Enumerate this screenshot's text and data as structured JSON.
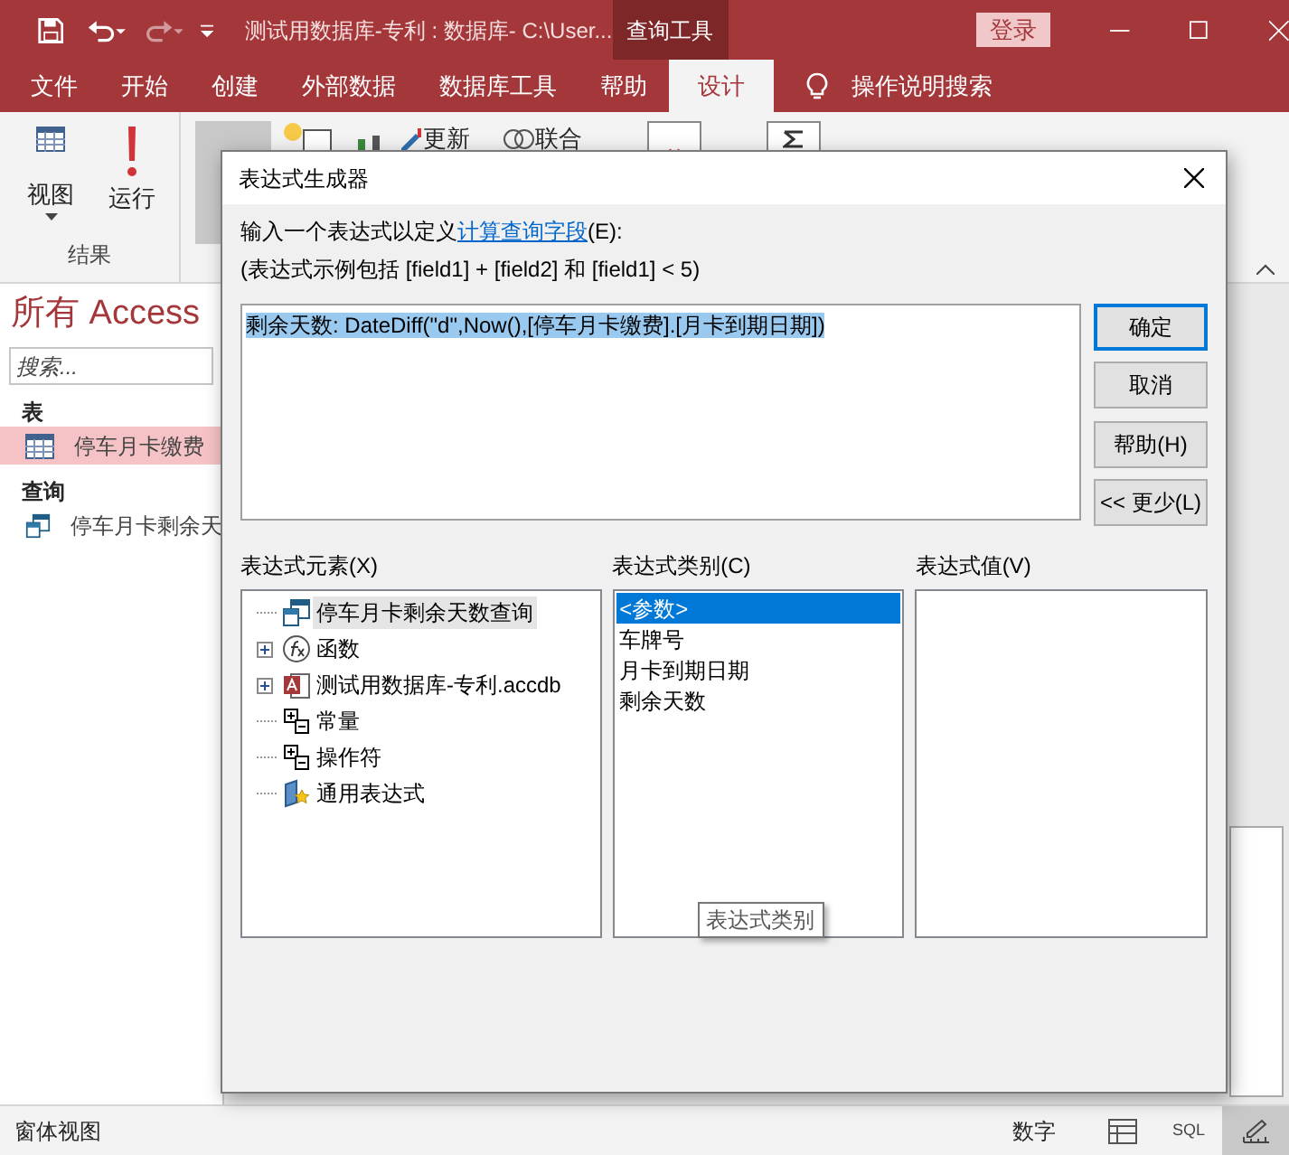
{
  "title_bar": {
    "title": "测试用数据库-专利 : 数据库- C:\\User...",
    "context_tab": "查询工具",
    "sign_in": "登录"
  },
  "ribbon_tabs": [
    {
      "label": "文件",
      "selected": false
    },
    {
      "label": "开始",
      "selected": false
    },
    {
      "label": "创建",
      "selected": false
    },
    {
      "label": "外部数据",
      "selected": false
    },
    {
      "label": "数据库工具",
      "selected": false
    },
    {
      "label": "帮助",
      "selected": false
    },
    {
      "label": "设计",
      "selected": true
    }
  ],
  "tell_me": "操作说明搜索",
  "ribbon": {
    "view": "视图",
    "run": "运行",
    "group_label": "结果",
    "update": "更新",
    "union": "联合"
  },
  "nav_pane": {
    "title": "所有 Access",
    "search": {
      "placeholder": "搜索..."
    },
    "groups": [
      {
        "label": "表",
        "items": [
          {
            "label": "停车月卡缴费",
            "kind": "table",
            "selected": true
          }
        ]
      },
      {
        "label": "查询",
        "items": [
          {
            "label": "停车月卡剩余天",
            "kind": "query",
            "selected": false
          }
        ]
      }
    ]
  },
  "dialog": {
    "title": "表达式生成器",
    "intro": {
      "text": "输入一个表达式以定义",
      "link": "计算查询字段",
      "suffix": "(E):"
    },
    "example": "(表达式示例包括 [field1] + [field2] 和 [field1] < 5)",
    "expression": {
      "value": "剩余天数: DateDiff(\"d\",Now(),[停车月卡缴费].[月卡到期日期])",
      "selected": true
    },
    "buttons": [
      {
        "label": "确定",
        "default": true
      },
      {
        "label": "取消",
        "default": false
      },
      {
        "label": "帮助(H)",
        "default": false
      },
      {
        "label": "<< 更少(L)",
        "default": false
      }
    ],
    "elements": {
      "label": "表达式元素(X)",
      "items": [
        {
          "label": "停车月卡剩余天数查询",
          "kind": "query",
          "expandable": false,
          "selected": true
        },
        {
          "label": "函数",
          "kind": "function",
          "expandable": true,
          "selected": false
        },
        {
          "label": "测试用数据库-专利.accdb",
          "kind": "database",
          "expandable": true,
          "selected": false
        },
        {
          "label": "常量",
          "kind": "constant",
          "expandable": false,
          "selected": false
        },
        {
          "label": "操作符",
          "kind": "constant",
          "expandable": false,
          "selected": false
        },
        {
          "label": "通用表达式",
          "kind": "common",
          "expandable": false,
          "selected": false
        }
      ]
    },
    "categories": {
      "label": "表达式类别(C)",
      "items": [
        {
          "label": "<参数>",
          "selected": true
        },
        {
          "label": "车牌号",
          "selected": false
        },
        {
          "label": "月卡到期日期",
          "selected": false
        },
        {
          "label": "剩余天数",
          "selected": false
        }
      ]
    },
    "values": {
      "label": "表达式值(V)"
    },
    "tooltip": "表达式类别"
  },
  "status_bar": {
    "left": "窗体视图",
    "mode": "数字",
    "views": [
      {
        "kind": "datasheet",
        "selected": false
      },
      {
        "kind": "sql",
        "label": "SQL",
        "selected": false
      },
      {
        "kind": "design",
        "selected": true
      }
    ]
  }
}
